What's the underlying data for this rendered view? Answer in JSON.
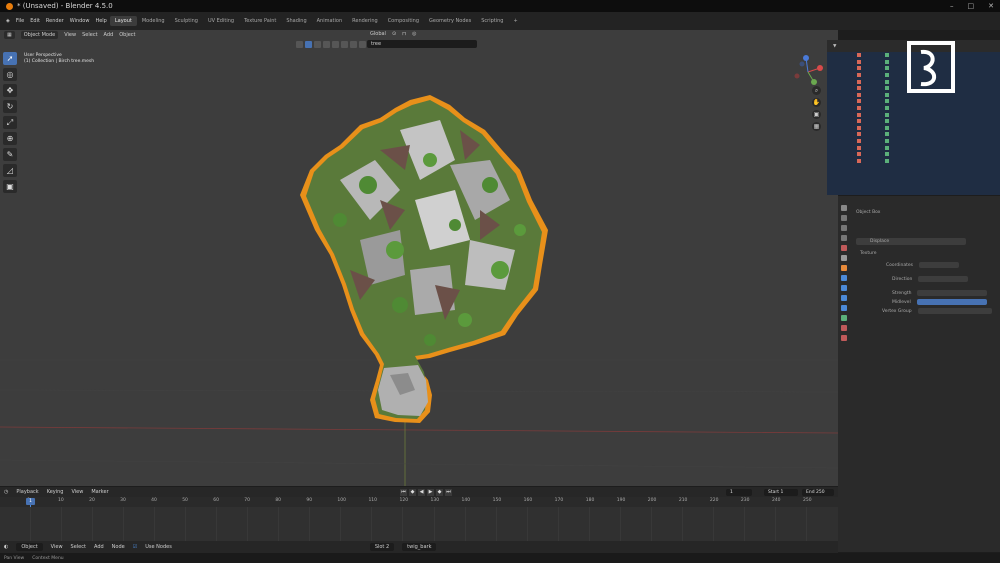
{
  "window": {
    "title": "* (Unsaved) - Blender 4.5.0"
  },
  "menu": {
    "items": [
      "File",
      "Edit",
      "Render",
      "Window",
      "Help"
    ]
  },
  "workspaces": {
    "tabs": [
      "Layout",
      "Modeling",
      "Sculpting",
      "UV Editing",
      "Texture Paint",
      "Shading",
      "Animation",
      "Rendering",
      "Compositing",
      "Geometry Nodes",
      "Scripting"
    ],
    "active": "Layout",
    "add": "+"
  },
  "viewport": {
    "mode": "Object Mode",
    "menus": [
      "View",
      "Select",
      "Add",
      "Object"
    ],
    "transform_orientation": "Global",
    "search_value": "tree",
    "perspective": "User Perspective",
    "collection_path": "(1) Collection | Birch tree.mesh",
    "tools": [
      "select",
      "cursor",
      "move",
      "rotate",
      "scale",
      "transform",
      "annotate",
      "measure",
      "add-cube"
    ]
  },
  "outliner": {
    "row_count": 17
  },
  "properties": {
    "labels": [
      "Object Box",
      "Displace",
      "Texture",
      "Coordinates",
      "Direction",
      "Strength",
      "Midlevel",
      "Vertex Group"
    ]
  },
  "timeline": {
    "menus": [
      "Playback",
      "Keying",
      "View",
      "Marker"
    ],
    "current_frame": "1",
    "start_label": "Start",
    "start": "1",
    "end_label": "End",
    "end": "250",
    "ticks": [
      "0",
      "10",
      "20",
      "30",
      "40",
      "50",
      "60",
      "70",
      "80",
      "90",
      "100",
      "110",
      "120",
      "130",
      "140",
      "150",
      "160",
      "170",
      "180",
      "190",
      "200",
      "210",
      "220",
      "230",
      "240",
      "250"
    ]
  },
  "node_editor": {
    "editor": "Object",
    "menus": [
      "View",
      "Select",
      "Add",
      "Node"
    ],
    "use_nodes": "Use Nodes",
    "slot": "Slot 2",
    "material": "twig_bark"
  },
  "statusbar": {
    "items": [
      "Pan View",
      "Context Menu"
    ]
  },
  "colors": {
    "accent": "#4772b3",
    "selection_outline": "#e8901a",
    "foliage": "#4f8a34",
    "bark": "#6b5048"
  }
}
